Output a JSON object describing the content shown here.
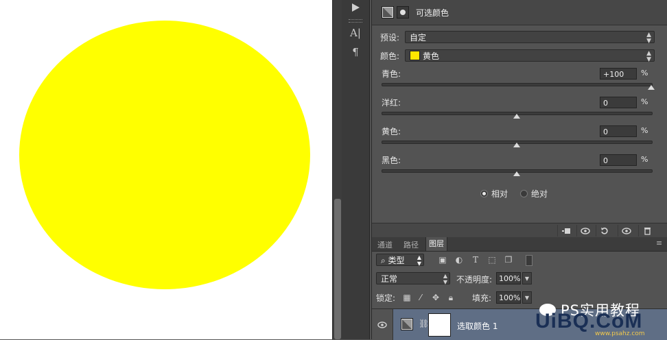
{
  "adjustments_panel": {
    "title": "可选颜色",
    "preset_label": "预设:",
    "preset_value": "自定",
    "colors_label": "颜色:",
    "colors_value": "黄色",
    "colors_swatch": "#ffe600",
    "sliders": [
      {
        "label": "青色:",
        "value": "+100",
        "unit": "%",
        "level": 1.0
      },
      {
        "label": "洋红:",
        "value": "0",
        "unit": "%",
        "level": 0.5
      },
      {
        "label": "黄色:",
        "value": "0",
        "unit": "%",
        "level": 0.5
      },
      {
        "label": "黑色:",
        "value": "0",
        "unit": "%",
        "level": 0.5
      }
    ],
    "method_relative": "相对",
    "method_absolute": "绝对",
    "selected_method": "相对"
  },
  "tools": {
    "play_icon": "play-icon",
    "character_icon": "character-panel-icon",
    "paragraph_icon": "paragraph-icon"
  },
  "layers_panel": {
    "tabs": [
      "通道",
      "路径",
      "图层"
    ],
    "active_tab": "图层",
    "filter_kind": "类型",
    "blend_mode": "正常",
    "opacity_label": "不透明度:",
    "opacity_value": "100%",
    "lock_label": "锁定:",
    "fill_label": "填充:",
    "fill_value": "100%",
    "layer_name": "选取颜色 1"
  },
  "watermark": {
    "title": "PS实用教程",
    "logo": "UiBQ.CoM",
    "url": "www.psahz.com"
  },
  "colors": {
    "canvas_shape": "#ffff00",
    "layer_selected": "#5f6e85"
  }
}
